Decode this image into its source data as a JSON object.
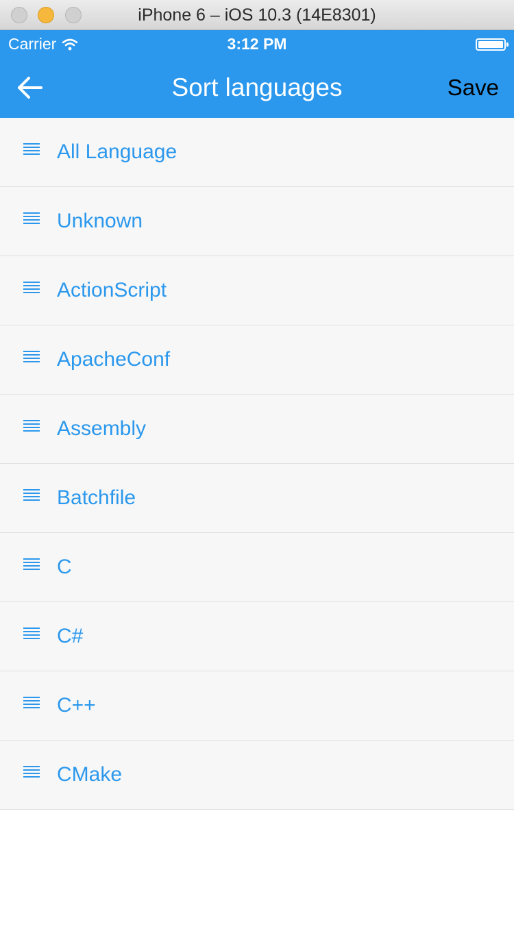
{
  "window": {
    "title": "iPhone 6 – iOS 10.3 (14E8301)"
  },
  "status_bar": {
    "carrier": "Carrier",
    "time": "3:12 PM"
  },
  "nav_bar": {
    "title": "Sort languages",
    "save_label": "Save"
  },
  "colors": {
    "accent": "#2b98ed",
    "list_background": "#f7f7f7",
    "divider": "#e0e0e0"
  },
  "languages": [
    {
      "label": "All Language"
    },
    {
      "label": "Unknown"
    },
    {
      "label": "ActionScript"
    },
    {
      "label": "ApacheConf"
    },
    {
      "label": "Assembly"
    },
    {
      "label": "Batchfile"
    },
    {
      "label": "C"
    },
    {
      "label": "C#"
    },
    {
      "label": "C++"
    },
    {
      "label": "CMake"
    }
  ]
}
